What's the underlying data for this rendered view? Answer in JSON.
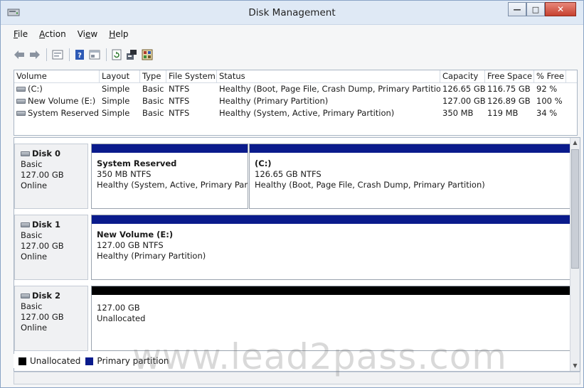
{
  "window": {
    "title": "Disk Management",
    "min_icon": "minimize-icon",
    "max_icon": "maximize-icon",
    "close_icon": "close-icon"
  },
  "menu": {
    "file": {
      "key": "F",
      "rest": "ile"
    },
    "action": {
      "key": "A",
      "rest": "ction"
    },
    "view": {
      "pre": "Vi",
      "key": "e",
      "rest": "w"
    },
    "help": {
      "key": "H",
      "rest": "elp"
    }
  },
  "toolbar": {
    "icons": [
      "back-arrow-icon",
      "forward-arrow-icon",
      "properties-icon",
      "help-icon",
      "console-icon",
      "refresh-icon",
      "export-icon",
      "settings-icon"
    ]
  },
  "volume_list": {
    "columns": [
      "Volume",
      "Layout",
      "Type",
      "File System",
      "Status",
      "Capacity",
      "Free Space",
      "% Free"
    ],
    "rows": [
      [
        "(C:)",
        "Simple",
        "Basic",
        "NTFS",
        "Healthy (Boot, Page File, Crash Dump, Primary Partition)",
        "126.65 GB",
        "116.75 GB",
        "92 %"
      ],
      [
        "New Volume (E:)",
        "Simple",
        "Basic",
        "NTFS",
        "Healthy (Primary Partition)",
        "127.00 GB",
        "126.89 GB",
        "100 %"
      ],
      [
        "System Reserved",
        "Simple",
        "Basic",
        "NTFS",
        "Healthy (System, Active, Primary Partition)",
        "350 MB",
        "119 MB",
        "34 %"
      ]
    ]
  },
  "disks": [
    {
      "name": "Disk 0",
      "type": "Basic",
      "size": "127.00 GB",
      "status": "Online",
      "partitions": [
        {
          "title": "System Reserved",
          "line1": "350 MB NTFS",
          "line2": "Healthy (System, Active, Primary Partit"
        },
        {
          "title": "(C:)",
          "line1": "126.65 GB NTFS",
          "line2": "Healthy (Boot, Page File, Crash Dump, Primary Partition)"
        }
      ]
    },
    {
      "name": "Disk 1",
      "type": "Basic",
      "size": "127.00 GB",
      "status": "Online",
      "partitions": [
        {
          "title": "New Volume  (E:)",
          "line1": "127.00 GB NTFS",
          "line2": "Healthy (Primary Partition)"
        }
      ]
    },
    {
      "name": "Disk 2",
      "type": "Basic",
      "size": "127.00 GB",
      "status": "Online",
      "partitions": [
        {
          "title": "",
          "line1": "127.00 GB",
          "line2": "Unallocated"
        }
      ]
    }
  ],
  "legend": {
    "unallocated": "Unallocated",
    "primary": "Primary partition"
  },
  "colors": {
    "primary_partition": "#0a1b8c",
    "unallocated": "#000000",
    "title_bar": "#dfe9f5",
    "close_button": "#c6412f"
  },
  "watermark": "www.lead2pass.com"
}
